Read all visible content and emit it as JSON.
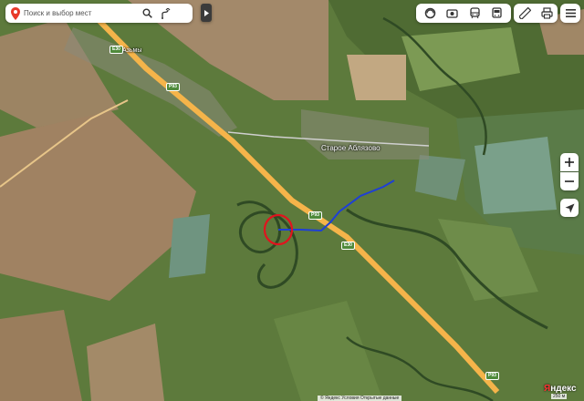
{
  "search": {
    "placeholder": "Поиск и выбор мест"
  },
  "labels": {
    "village_1": "Азьмы",
    "village_2": "Старое Аблязово",
    "road_shield_1": "Р93",
    "road_shield_2": "Р93",
    "road_shield_3": "Е30",
    "road_shield_4": "Е30",
    "road_shield_5": "Р93"
  },
  "brand": {
    "logo_main": "Яндекс",
    "logo_accent": "Я"
  },
  "footer": {
    "attribution": "© Яндекс Условия Открытые данные",
    "scale": "250 м"
  },
  "colors": {
    "marker_circle": "#e0141e",
    "route": "#1e3fd6",
    "highway": "#f5b44a",
    "pin": "#e83a2a"
  },
  "icons": {
    "search": "search-icon",
    "route": "route-icon",
    "layers": "layers-icon",
    "panorama": "panorama-icon",
    "transit": "transit-icon",
    "bus": "bus-icon",
    "ruler": "ruler-icon",
    "print": "print-icon",
    "menu": "menu-icon",
    "locate": "locate-icon"
  }
}
